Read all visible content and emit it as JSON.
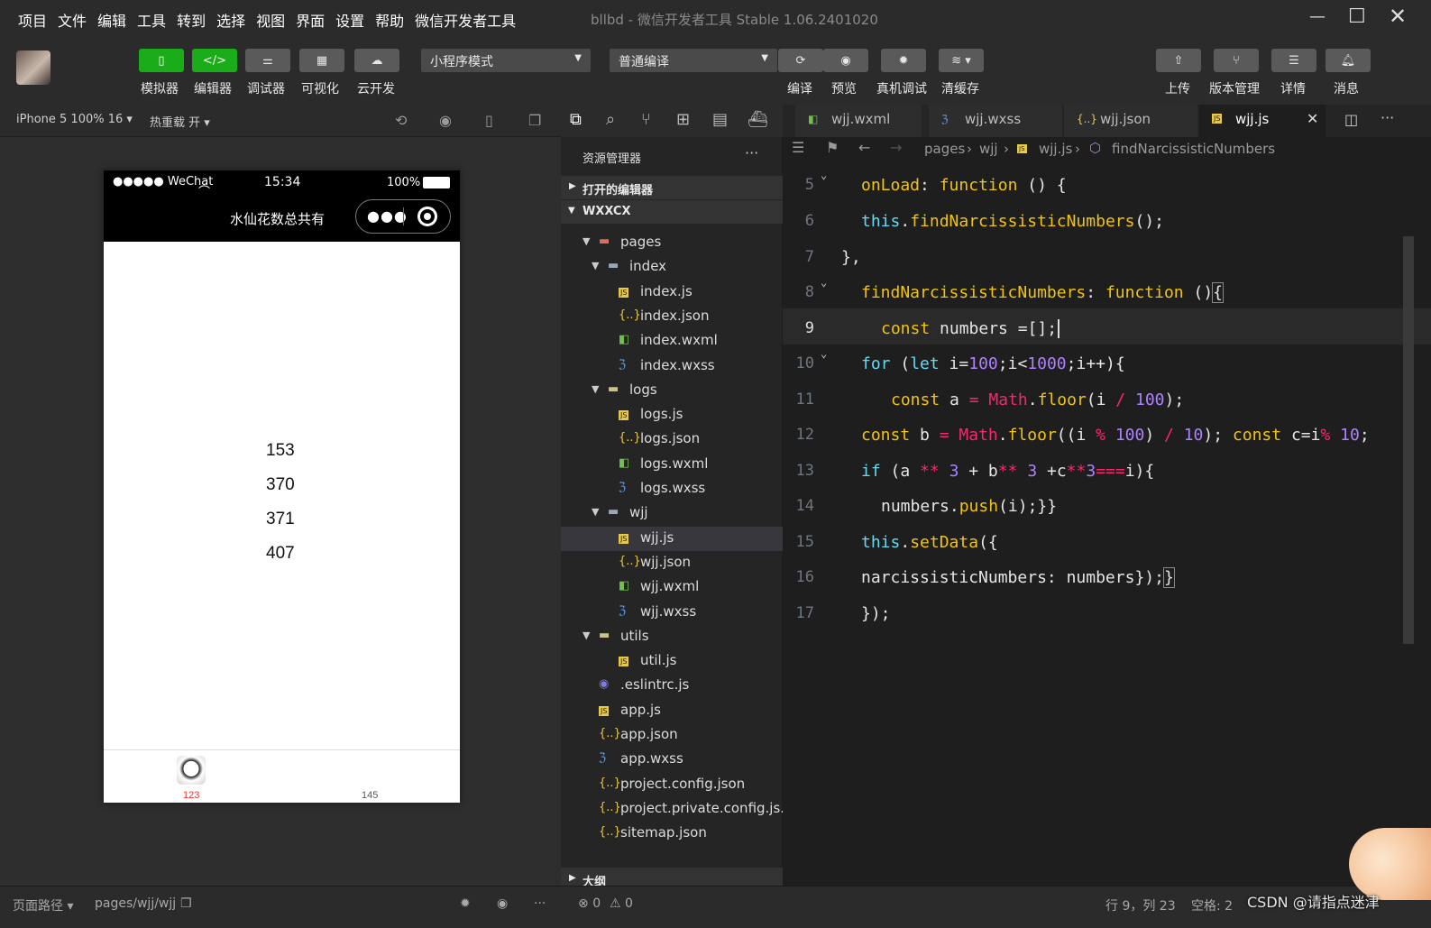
{
  "menu": [
    "项目",
    "文件",
    "编辑",
    "工具",
    "转到",
    "选择",
    "视图",
    "界面",
    "设置",
    "帮助",
    "微信开发者工具"
  ],
  "window_title": "bllbd - 微信开发者工具 Stable 1.06.2401020",
  "toolbar": {
    "simulator": "模拟器",
    "editor": "编辑器",
    "debugger": "调试器",
    "visual": "可视化",
    "cloud": "云开发",
    "mode_select": "小程序模式",
    "compile_select": "普通编译",
    "compile": "编译",
    "preview": "预览",
    "real_debug": "真机调试",
    "clear_cache": "清缓存",
    "upload": "上传",
    "version": "版本管理",
    "details": "详情",
    "messages": "消息"
  },
  "simulator": {
    "device": "iPhone 5 100% 16",
    "hot_reload": "热重载 开",
    "status_signal": "●●●●● WeChat",
    "status_time": "15:34",
    "status_battery": "100%",
    "nav_title": "水仙花数总共有",
    "numbers": [
      "153",
      "370",
      "371",
      "407"
    ],
    "tab_left": "123",
    "tab_right": "145"
  },
  "explorer": {
    "title": "资源管理器",
    "open_editors": "打开的编辑器",
    "project": "WXXCX",
    "outline": "大纲",
    "tree": [
      {
        "label": "pages",
        "type": "folder-red",
        "indent": 1,
        "arrow": "▼"
      },
      {
        "label": "index",
        "type": "folder",
        "indent": 2,
        "arrow": "▼"
      },
      {
        "label": "index.js",
        "type": "js",
        "indent": 3
      },
      {
        "label": "index.json",
        "type": "json",
        "indent": 3
      },
      {
        "label": "index.wxml",
        "type": "wxml",
        "indent": 3
      },
      {
        "label": "index.wxss",
        "type": "wxss",
        "indent": 3
      },
      {
        "label": "logs",
        "type": "folder-green",
        "indent": 2,
        "arrow": "▼"
      },
      {
        "label": "logs.js",
        "type": "js",
        "indent": 3
      },
      {
        "label": "logs.json",
        "type": "json",
        "indent": 3
      },
      {
        "label": "logs.wxml",
        "type": "wxml",
        "indent": 3
      },
      {
        "label": "logs.wxss",
        "type": "wxss",
        "indent": 3
      },
      {
        "label": "wjj",
        "type": "folder",
        "indent": 2,
        "arrow": "▼"
      },
      {
        "label": "wjj.js",
        "type": "js",
        "indent": 3,
        "selected": true
      },
      {
        "label": "wjj.json",
        "type": "json",
        "indent": 3
      },
      {
        "label": "wjj.wxml",
        "type": "wxml",
        "indent": 3
      },
      {
        "label": "wjj.wxss",
        "type": "wxss",
        "indent": 3
      },
      {
        "label": "utils",
        "type": "folder-green",
        "indent": 1,
        "arrow": "▼"
      },
      {
        "label": "util.js",
        "type": "js",
        "indent": 2
      },
      {
        "label": ".eslintrc.js",
        "type": "eslint",
        "indent": 1
      },
      {
        "label": "app.js",
        "type": "js",
        "indent": 1
      },
      {
        "label": "app.json",
        "type": "json",
        "indent": 1
      },
      {
        "label": "app.wxss",
        "type": "wxss",
        "indent": 1
      },
      {
        "label": "project.config.json",
        "type": "json",
        "indent": 1
      },
      {
        "label": "project.private.config.js...",
        "type": "json",
        "indent": 1
      },
      {
        "label": "sitemap.json",
        "type": "json",
        "indent": 1
      }
    ]
  },
  "editor": {
    "tabs": [
      {
        "label": "wjj.wxml",
        "type": "wxml"
      },
      {
        "label": "wjj.wxss",
        "type": "wxss"
      },
      {
        "label": "wjj.json",
        "type": "json"
      },
      {
        "label": "wjj.js",
        "type": "js",
        "active": true
      }
    ],
    "breadcrumb": [
      "pages",
      "wjj",
      "wjj.js",
      "findNarcissisticNumbers"
    ],
    "line_numbers": [
      "5",
      "6",
      "7",
      "8",
      "9",
      "10",
      "11",
      "12",
      "13",
      "14",
      "15",
      "16",
      "17"
    ],
    "current_line": "9"
  },
  "status": {
    "page_path_label": "页面路径",
    "page_path": "pages/wjj/wjj",
    "errors": "0",
    "warnings": "0",
    "cursor": "行 9，列 23",
    "spaces": "空格: 2",
    "watermark": "CSDN @请指点迷津"
  },
  "colors": {
    "green": "#1aad19",
    "keyword": "#f1c40f",
    "number": "#ae81ff",
    "function": "#a6e22e",
    "operator": "#f92672"
  }
}
